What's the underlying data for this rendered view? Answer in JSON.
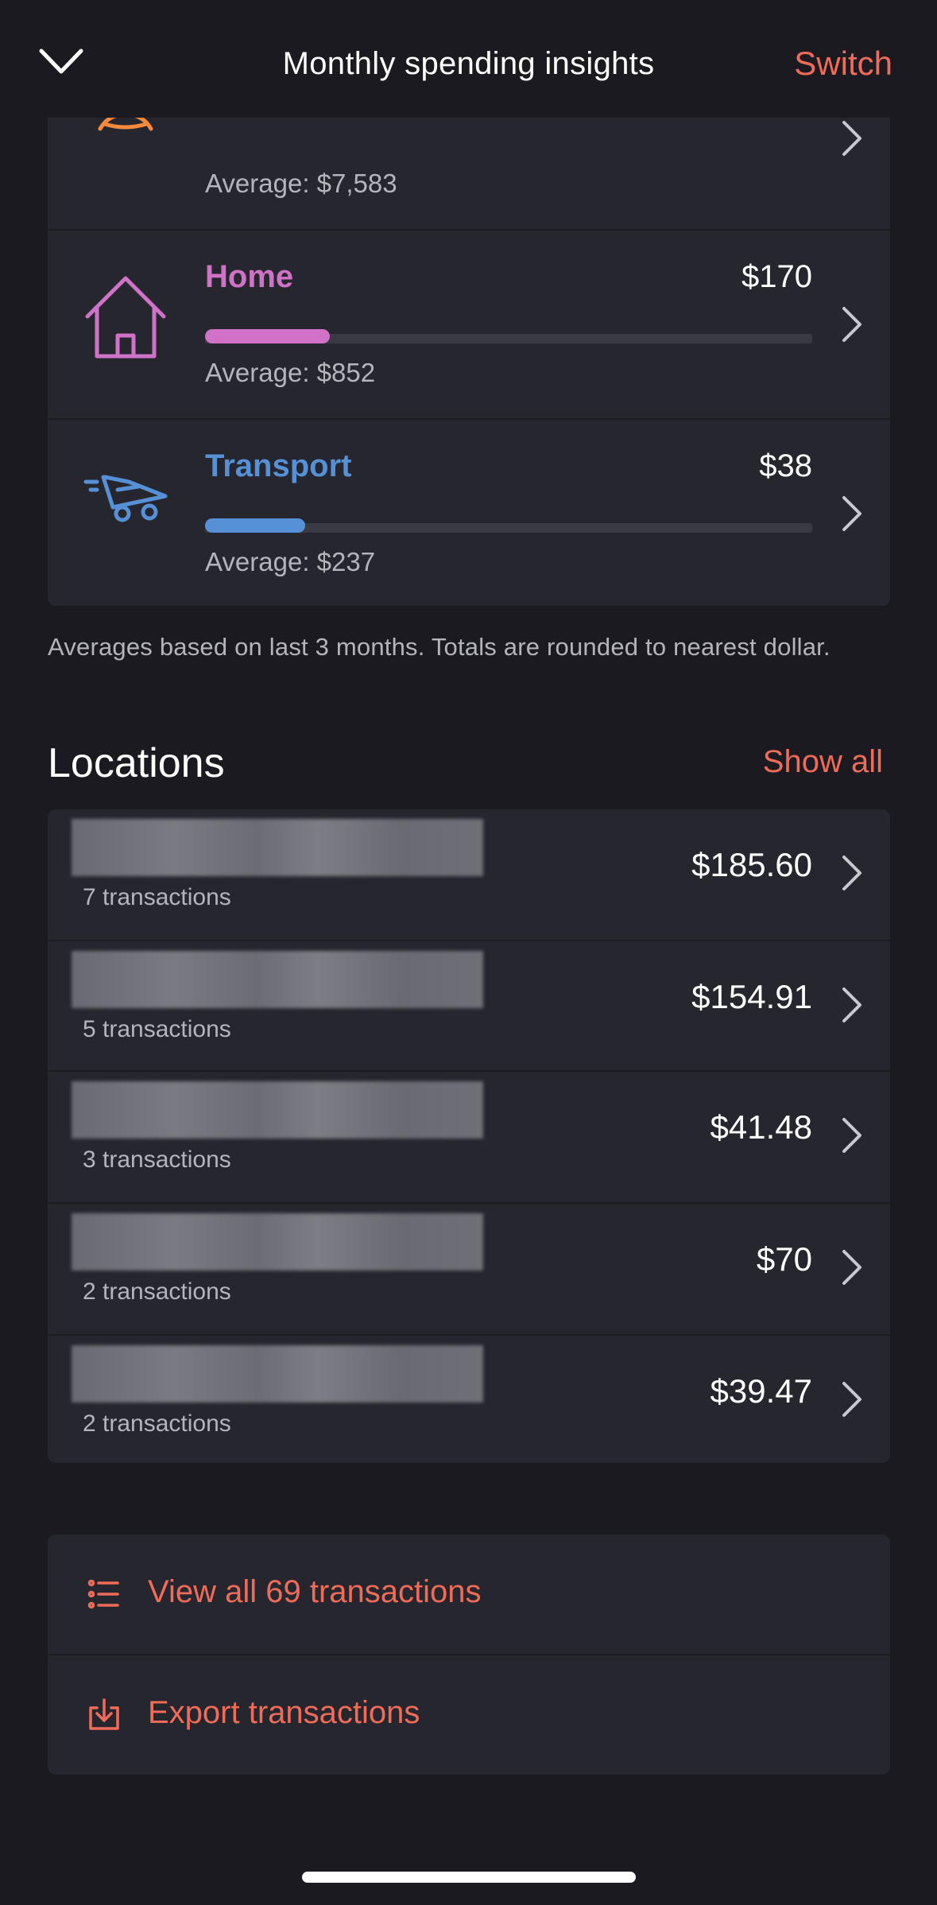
{
  "header": {
    "title": "Monthly spending insights",
    "switch_label": "Switch"
  },
  "categories": [
    {
      "name": "",
      "amount": "",
      "average": "Average: $7,583",
      "progress": 0.98,
      "color": "#f78a3b",
      "icon": "camping-tent-icon"
    },
    {
      "name": "Home",
      "amount": "$170",
      "average": "Average: $852",
      "progress": 0.2,
      "color": "#cf72c8",
      "icon": "house-icon"
    },
    {
      "name": "Transport",
      "amount": "$38",
      "average": "Average: $237",
      "progress": 0.165,
      "color": "#5690d6",
      "icon": "delivery-cart-icon"
    }
  ],
  "footnote": "Averages based on last 3 months. Totals are rounded to nearest dollar.",
  "locations": {
    "title": "Locations",
    "show_all_label": "Show all",
    "items": [
      {
        "transactions": "7 transactions",
        "amount": "$185.60"
      },
      {
        "transactions": "5 transactions",
        "amount": "$154.91"
      },
      {
        "transactions": "3 transactions",
        "amount": "$41.48"
      },
      {
        "transactions": "2 transactions",
        "amount": "$70"
      },
      {
        "transactions": "2 transactions",
        "amount": "$39.47"
      }
    ]
  },
  "actions": {
    "view_all": "View all 69 transactions",
    "export": "Export transactions"
  },
  "colors": {
    "accent": "#f06b58",
    "background": "#1a1a20",
    "card": "#26262e"
  }
}
